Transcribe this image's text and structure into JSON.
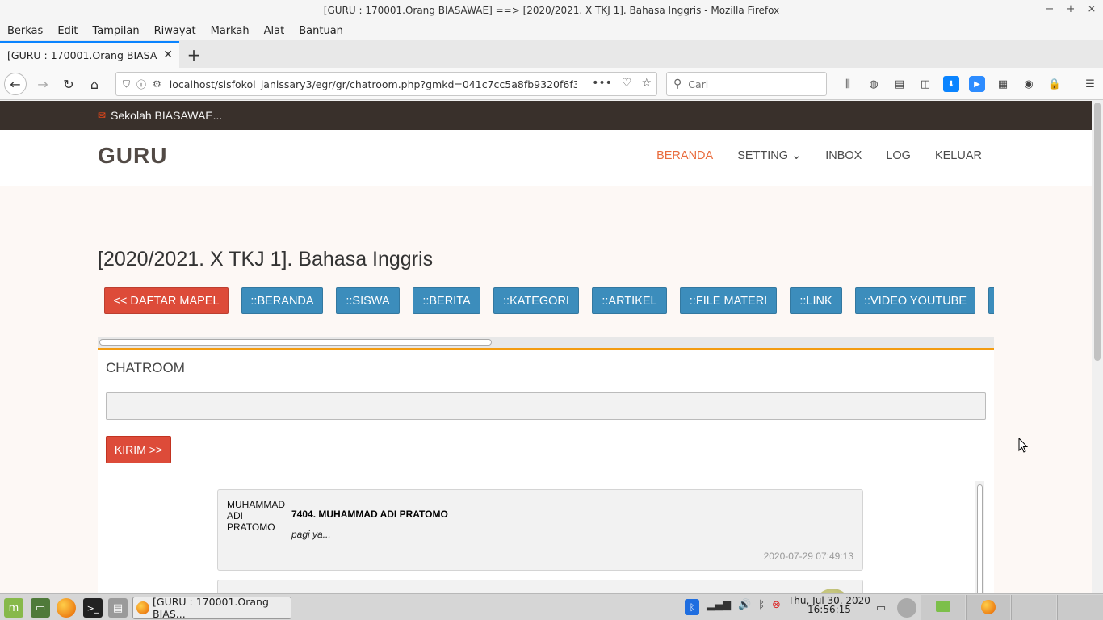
{
  "window": {
    "title": "[GURU : 170001.Orang BIASAWAE] ==> [2020/2021. X TKJ 1]. Bahasa Inggris - Mozilla Firefox"
  },
  "menubar": {
    "items": [
      "Berkas",
      "Edit",
      "Tampilan",
      "Riwayat",
      "Markah",
      "Alat",
      "Bantuan"
    ]
  },
  "tabs": [
    {
      "label": "[GURU : 170001.Orang BIASAWAE",
      "active": true
    }
  ],
  "navbar": {
    "url": "localhost/sisfokol_janissary3/egr/gr/chatroom.php?gmkd=041c7cc5a8fb9320f6f3b538ce5",
    "search_placeholder": "Cari"
  },
  "site": {
    "topbar_text": "Sekolah BIASAWAE...",
    "logo": "GURU",
    "nav": [
      {
        "label": "BERANDA",
        "active": true
      },
      {
        "label": "SETTING ⌄",
        "active": false
      },
      {
        "label": "INBOX",
        "active": false
      },
      {
        "label": "LOG",
        "active": false
      },
      {
        "label": "KELUAR",
        "active": false
      }
    ],
    "page_title": "[2020/2021. X TKJ 1]. Bahasa Inggris",
    "buttons": [
      {
        "label": "<< DAFTAR MAPEL",
        "color": "#dd4b39"
      },
      {
        "label": "::BERANDA",
        "color": "#3c8dbc"
      },
      {
        "label": "::SISWA",
        "color": "#3c8dbc"
      },
      {
        "label": "::BERITA",
        "color": "#3c8dbc"
      },
      {
        "label": "::KATEGORI",
        "color": "#3c8dbc"
      },
      {
        "label": "::ARTIKEL",
        "color": "#3c8dbc"
      },
      {
        "label": "::FILE MATERI",
        "color": "#3c8dbc"
      },
      {
        "label": "::LINK",
        "color": "#3c8dbc"
      },
      {
        "label": "::VIDEO YOUTUBE",
        "color": "#3c8dbc"
      }
    ]
  },
  "chatroom": {
    "title": "CHATROOM",
    "input_value": "",
    "send_label": "KIRIM >>",
    "messages": [
      {
        "sender_short": "MUHAMMAD ADI PRATOMO",
        "sender_full": "7404. MUHAMMAD ADI PRATOMO",
        "text": "pagi ya...",
        "time": "2020-07-29 07:49:13"
      }
    ]
  },
  "taskbar": {
    "task_label": "[GURU : 170001.Orang BIAS...",
    "clock_date": "Thu, Jul 30, 2020",
    "clock_time": "16:56:15"
  },
  "colors": {
    "accent_orange": "#e96b3c",
    "button_red": "#dd4b39",
    "button_blue": "#3c8dbc",
    "panel_border": "#f39c12",
    "topbar_bg": "#39302b"
  }
}
